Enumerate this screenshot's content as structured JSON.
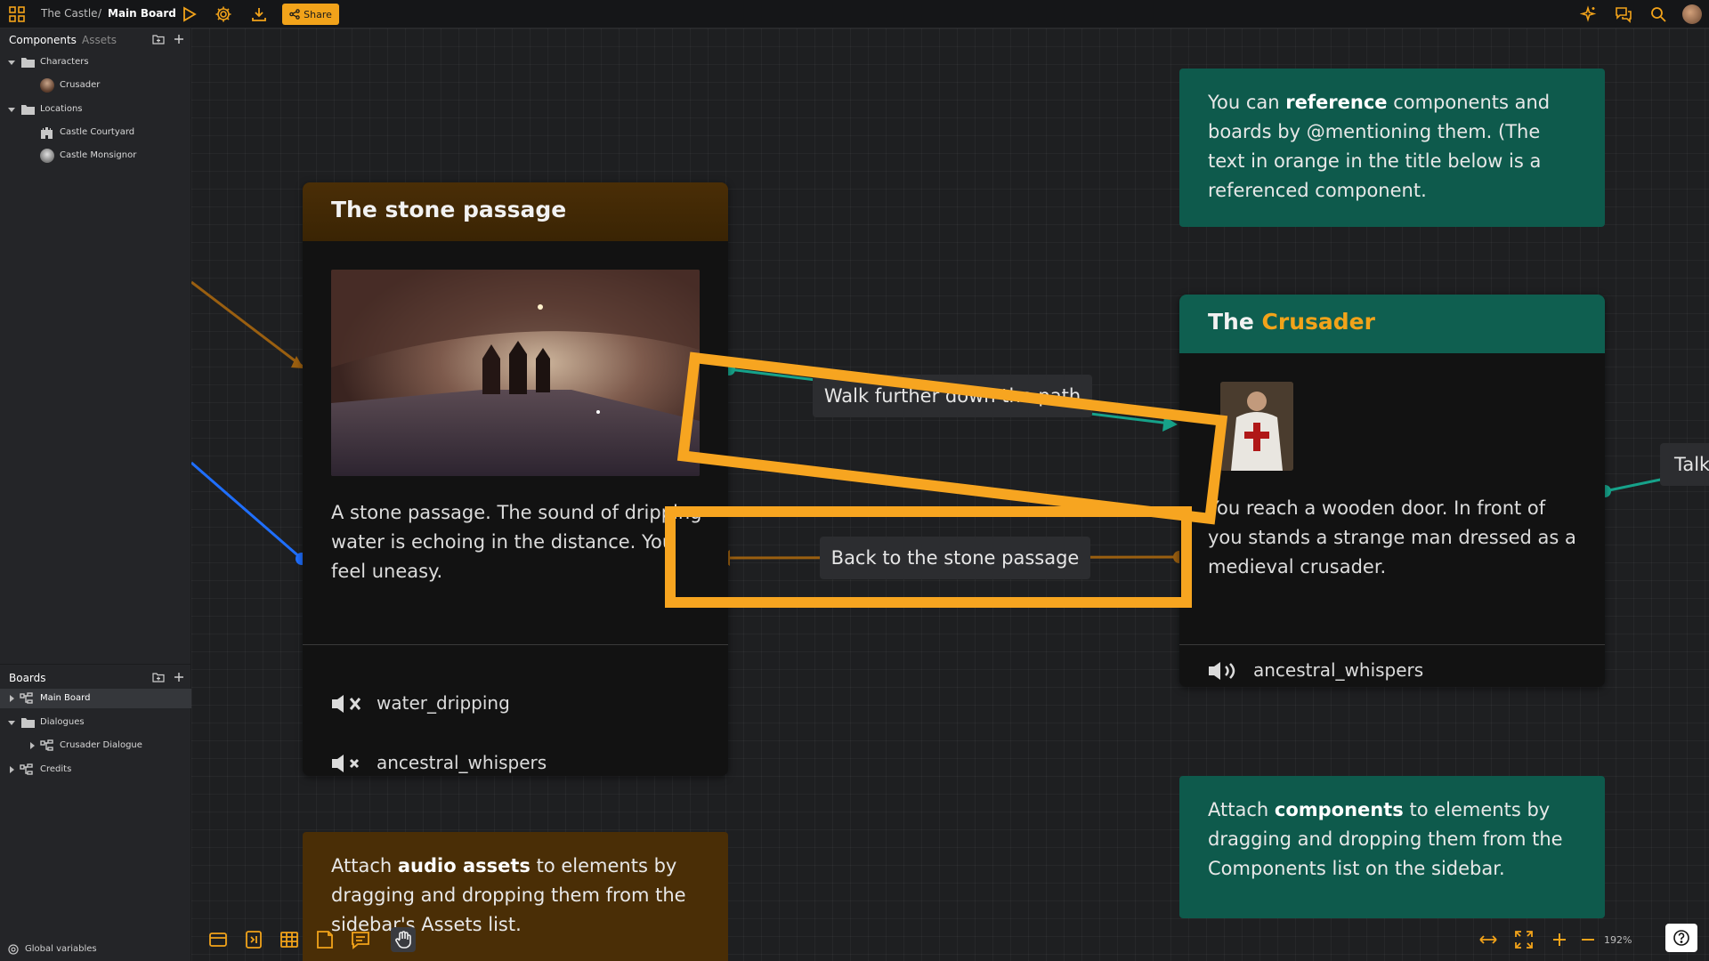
{
  "header": {
    "project": "The Castle",
    "separator": "/",
    "board": "Main Board",
    "share_label": "Share"
  },
  "sidebar": {
    "tabs": [
      "Components",
      "Assets"
    ],
    "components": [
      {
        "label": "Characters",
        "type": "folder"
      },
      {
        "label": "Crusader",
        "type": "item"
      },
      {
        "label": "Locations",
        "type": "folder"
      },
      {
        "label": "Castle Courtyard",
        "type": "item"
      },
      {
        "label": "Castle Monsignor",
        "type": "item"
      }
    ],
    "boards_title": "Boards",
    "boards": [
      {
        "label": "Main Board"
      },
      {
        "label": "Dialogues"
      },
      {
        "label": "Crusader Dialogue"
      },
      {
        "label": "Credits"
      }
    ],
    "global_variables": "Global variables"
  },
  "canvas": {
    "stone_card": {
      "title": "The stone passage",
      "body": "A stone passage. The sound of dripping water is echoing in the distance. You feel uneasy.",
      "audio": [
        "water_dripping",
        "ancestral_whispers"
      ]
    },
    "crusader_card": {
      "title_prefix": "The",
      "title_ref": "Crusader",
      "body": "You reach a wooden door. In front of you stands a strange man dressed as a medieval crusader.",
      "audio": [
        "ancestral_whispers"
      ]
    },
    "note_reference": {
      "pre": "You can",
      "bold": "reference",
      "post": "components and boards by @mentioning them. (The text in orange in the title below is a referenced component."
    },
    "note_components": {
      "pre": "Attach",
      "bold": "components",
      "post": "to elements by dragging and dropping them from the Components list on the sidebar."
    },
    "note_audio": {
      "pre": "Attach",
      "bold": "audio assets",
      "post": "to elements by dragging and dropping them from the sidebar's Assets list."
    },
    "connections": {
      "forward": "Walk further down the path",
      "back": "Back to the stone passage",
      "talk": "Talk"
    }
  },
  "zoom": {
    "level": "192%"
  },
  "colors": {
    "accent": "#f2a31a",
    "highlight": "#f7a520",
    "teal_note": "#0e5a4c",
    "teal_header": "#0f5f50",
    "orange_header": "#4a2e06",
    "wire_teal": "#16a28a",
    "wire_orange": "#9a5f10",
    "wire_blue": "#1f6fff"
  }
}
